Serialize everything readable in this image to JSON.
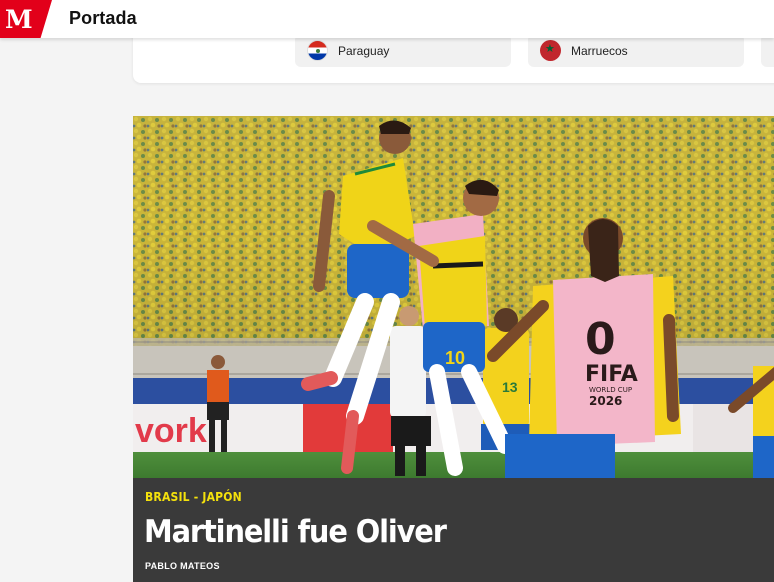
{
  "header": {
    "logo_text": "M",
    "logo_color": "#e2001a",
    "section_title": "Portada"
  },
  "matches": {
    "teams": [
      {
        "name": "Paraguay",
        "flag_icon": "paraguay-flag-icon"
      },
      {
        "name": "Marruecos",
        "flag_icon": "morocco-flag-icon"
      },
      {
        "name": "",
        "flag_icon": "partial-flag-icon"
      }
    ]
  },
  "article": {
    "image_description_icon": "football-photo",
    "kicker": "BRASIL - JAPÓN",
    "kicker_color": "#f4e10c",
    "headline": "Martinelli fue Oliver",
    "byline": "PABLO MATEOS",
    "band_color": "#3a3a3a",
    "photo_ad_text": "vork",
    "shirt_text_1": "FIFA",
    "shirt_text_2": "WORLD CUP",
    "shirt_text_3": "2026",
    "player_number": "10",
    "player_number_2": "13"
  }
}
